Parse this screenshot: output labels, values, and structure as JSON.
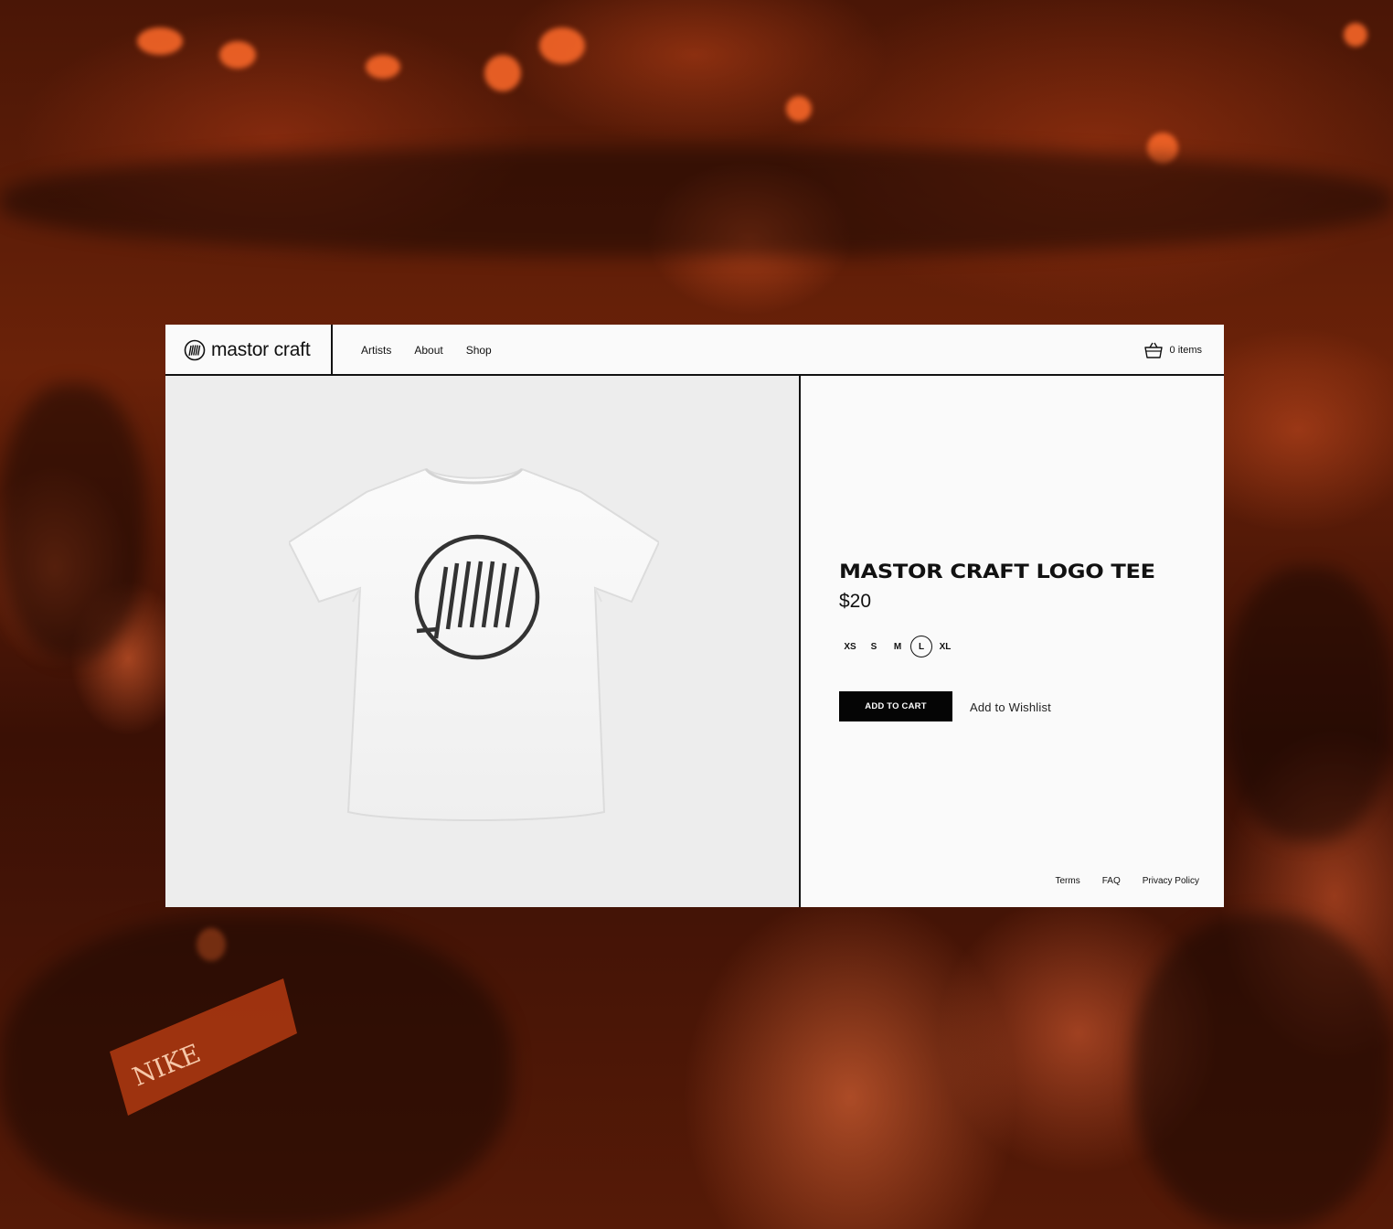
{
  "brand": {
    "name": "mastor craft"
  },
  "nav": {
    "items": [
      "Artists",
      "About",
      "Shop"
    ]
  },
  "cart": {
    "count_label": "0 items"
  },
  "product": {
    "title": "MASTOR CRAFT LOGO TEE",
    "price": "$20",
    "sizes": [
      "XS",
      "S",
      "M",
      "L",
      "XL"
    ],
    "selected_size": "L",
    "add_to_cart_label": "ADD TO CART",
    "wishlist_label": "Add to Wishlist"
  },
  "footer": {
    "links": [
      "Terms",
      "FAQ",
      "Privacy Policy"
    ]
  },
  "background_shirt_text": "NIKE",
  "colors": {
    "background_tint": "#c2440f",
    "button": "#050505",
    "panel": "#fafafa",
    "image_bg": "#ededed"
  }
}
